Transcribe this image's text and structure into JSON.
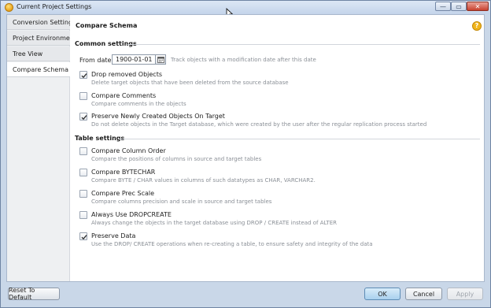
{
  "window": {
    "title": "Current Project Settings",
    "icon": "app-icon",
    "buttons": {
      "minimize": "—",
      "maximize": "▭",
      "close": "✕"
    }
  },
  "sidebar": {
    "items": [
      {
        "label": "Conversion Settings",
        "active": false
      },
      {
        "label": "Project Environment",
        "active": false
      },
      {
        "label": "Tree View",
        "active": false
      },
      {
        "label": "Compare Schema",
        "active": true
      }
    ]
  },
  "panel": {
    "title": "Compare Schema",
    "help_icon": "?",
    "common": {
      "title": "Common settings",
      "from_date_label": "From date",
      "from_date_value": "1900-01-01",
      "from_date_hint": "Track objects with a modification date after this date",
      "options": [
        {
          "label": "Drop removed Objects",
          "desc": "Delete target objects that have been deleted from the source database",
          "checked": true
        },
        {
          "label": "Compare Comments",
          "desc": "Compare comments in the objects",
          "checked": false
        },
        {
          "label": "Preserve Newly Created Objects On Target",
          "desc": "Do not delete objects in the Target database, which were created by the user after the regular replication process started",
          "checked": true
        }
      ]
    },
    "table": {
      "title": "Table settings",
      "options": [
        {
          "label": "Compare Column Order",
          "desc": "Compare the positions of columns in source and target tables",
          "checked": false
        },
        {
          "label": "Compare BYTECHAR",
          "desc": "Compare BYTE / CHAR values in columns of such datatypes as CHAR, VARCHAR2.",
          "checked": false
        },
        {
          "label": "Compare Prec Scale",
          "desc": "Compare columns precision and scale in source and target tables",
          "checked": false
        },
        {
          "label": "Always Use DROPCREATE",
          "desc": "Always change the objects in the target database using DROP / CREATE instead of ALTER",
          "checked": false
        },
        {
          "label": "Preserve Data",
          "desc": "Use the DROP/ CREATE operations when re-creating a table, to ensure safety and integrity of the data",
          "checked": true
        }
      ]
    }
  },
  "footer": {
    "reset_label": "Reset To Default",
    "ok_label": "OK",
    "cancel_label": "Cancel",
    "apply_label": "Apply"
  },
  "colors": {
    "accent": "#a9d0ee",
    "frame": "#c9d7e8",
    "help": "#f1b51c",
    "close": "#c8422f"
  }
}
